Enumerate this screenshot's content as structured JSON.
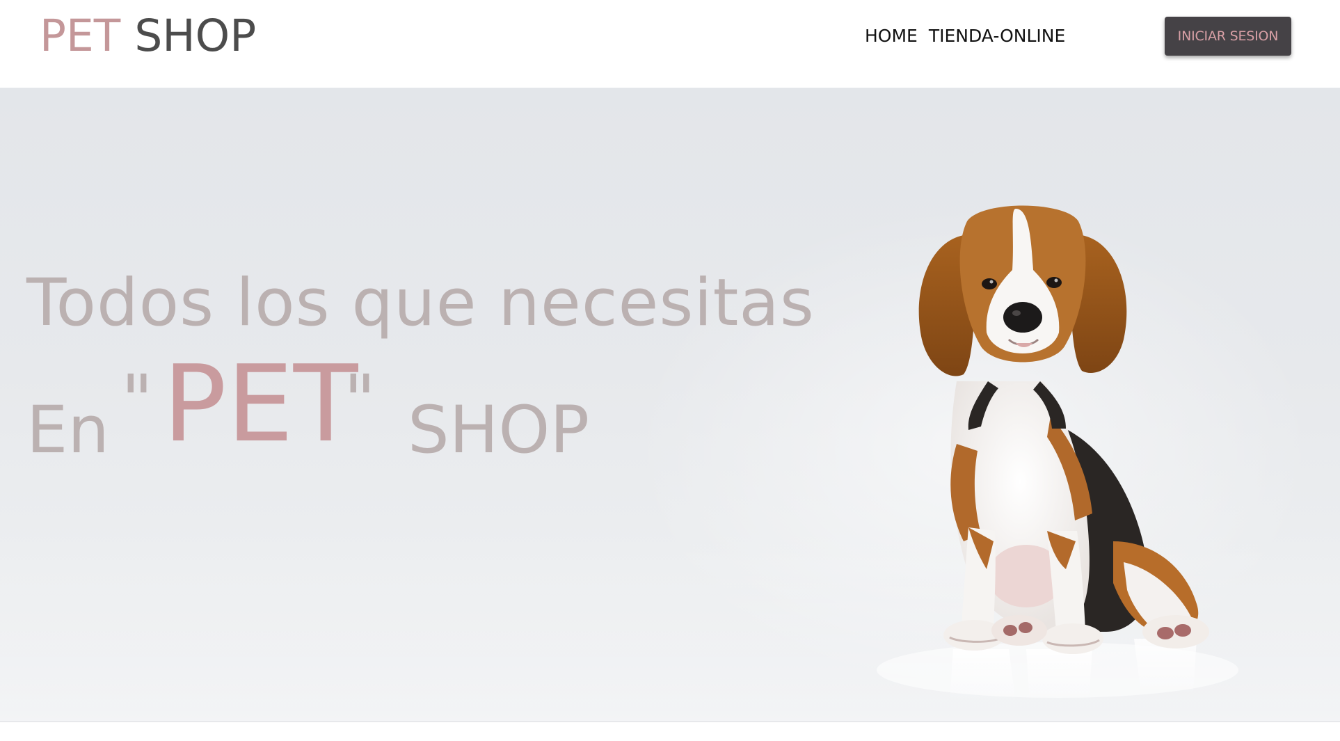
{
  "navbar": {
    "brand_pet": "PET",
    "brand_shop": "SHOP",
    "links": [
      {
        "label": "HOME"
      },
      {
        "label": "TIENDA-ONLINE"
      }
    ],
    "login_label": "INICIAR SESION"
  },
  "hero": {
    "line1": "Todos los que necesitas",
    "line2_en": "En",
    "line2_quote_open": "\"",
    "line2_pet": "PET",
    "line2_quote_close": "\"",
    "line2_shop": "SHOP",
    "image": "beagle-puppy-photo"
  },
  "colors": {
    "brand_pink": "#c49799",
    "brand_dark": "#4c4c4c",
    "button_bg": "#454246",
    "button_text": "#d9a0a6",
    "hero_text": "#bbb1b1",
    "hero_pet": "#c99b9e"
  }
}
